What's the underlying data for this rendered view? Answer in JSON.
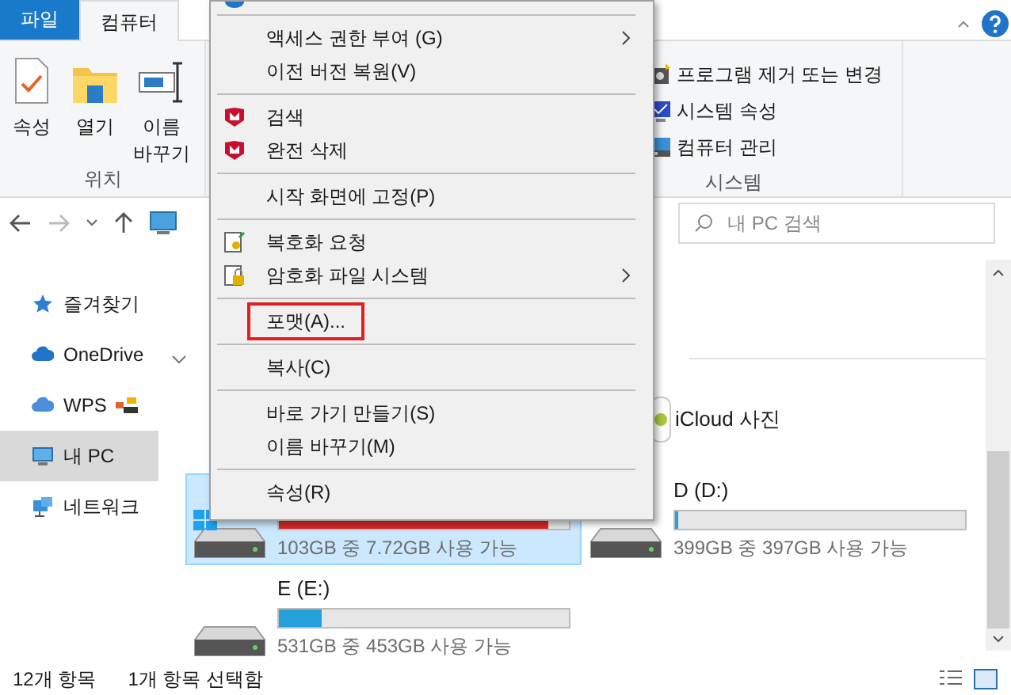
{
  "ribbon": {
    "tabs": [
      {
        "label": "파일",
        "kind": "file",
        "selected": false
      },
      {
        "label": "컴퓨터",
        "kind": "tab",
        "selected": true
      }
    ],
    "location_group": {
      "label": "위치",
      "buttons": [
        {
          "label": "속성",
          "kind": "props"
        },
        {
          "label": "열기",
          "kind": "open"
        },
        {
          "label": "이름\n바꾸기",
          "kind": "rename"
        }
      ]
    },
    "system_group": {
      "label": "시스템",
      "buttons": [
        {
          "label": "프로그램 제거 또는 변경",
          "kind": "uninstall"
        },
        {
          "label": "시스템 속성",
          "kind": "sysprops"
        },
        {
          "label": "컴퓨터 관리",
          "kind": "manage"
        }
      ]
    }
  },
  "search": {
    "placeholder": "내 PC 검색"
  },
  "sidebar": {
    "items": [
      {
        "label": "즐겨찾기",
        "kind": "star",
        "selected": false
      },
      {
        "label": "OneDrive",
        "kind": "cloud",
        "selected": false
      },
      {
        "label": "WPS",
        "kind": "wps",
        "selected": false
      },
      {
        "label": "내 PC",
        "kind": "pc",
        "selected": true
      },
      {
        "label": "네트워크",
        "kind": "network",
        "selected": false
      }
    ]
  },
  "icloud": {
    "label": "iCloud 사진"
  },
  "drives": [
    {
      "system": true,
      "level": 0.93,
      "low_space": true,
      "free": "103GB 중 7.72GB 사용 가능",
      "selected": true
    },
    {
      "name": "D (D:)",
      "system": false,
      "level": 0.01,
      "low_space": false,
      "free": "399GB 중 397GB 사용 가능",
      "selected": false
    },
    {
      "name": "E (E:)",
      "system": false,
      "level": 0.15,
      "low_space": false,
      "free": "531GB 중 453GB 사용 가능",
      "selected": false
    }
  ],
  "status_bar": {
    "count": "12개 항목",
    "selection": "1개 항목 선택함"
  },
  "context_menu": [
    {
      "kind": "cut"
    },
    {
      "kind": "separator"
    },
    {
      "kind": "plain",
      "label": "액세스 권한 부여 (G)",
      "submenu": true,
      "highlighted": false
    },
    {
      "kind": "plain",
      "label": "이전 버전 복원(V)",
      "submenu": false,
      "highlighted": false
    },
    {
      "kind": "separator"
    },
    {
      "kind": "shield",
      "label": "검색",
      "submenu": false,
      "highlighted": false
    },
    {
      "kind": "shield",
      "label": "완전 삭제",
      "submenu": false,
      "highlighted": false
    },
    {
      "kind": "separator"
    },
    {
      "kind": "plain",
      "label": "시작 화면에 고정(P)",
      "submenu": false,
      "highlighted": false
    },
    {
      "kind": "separator"
    },
    {
      "kind": "decrypt",
      "label": "복호화 요청",
      "submenu": false,
      "highlighted": false
    },
    {
      "kind": "lock",
      "label": "암호화 파일 시스템",
      "submenu": true,
      "highlighted": false
    },
    {
      "kind": "separator"
    },
    {
      "kind": "plain",
      "label": "포맷(A)...",
      "submenu": false,
      "highlighted": true
    },
    {
      "kind": "separator"
    },
    {
      "kind": "plain",
      "label": "복사(C)",
      "submenu": false,
      "highlighted": false
    },
    {
      "kind": "separator"
    },
    {
      "kind": "plain",
      "label": "바로 가기 만들기(S)",
      "submenu": false,
      "highlighted": false
    },
    {
      "kind": "plain",
      "label": "이름 바꾸기(M)",
      "submenu": false,
      "highlighted": false
    },
    {
      "kind": "separator"
    },
    {
      "kind": "plain",
      "label": "속성(R)",
      "submenu": false,
      "highlighted": false
    }
  ]
}
